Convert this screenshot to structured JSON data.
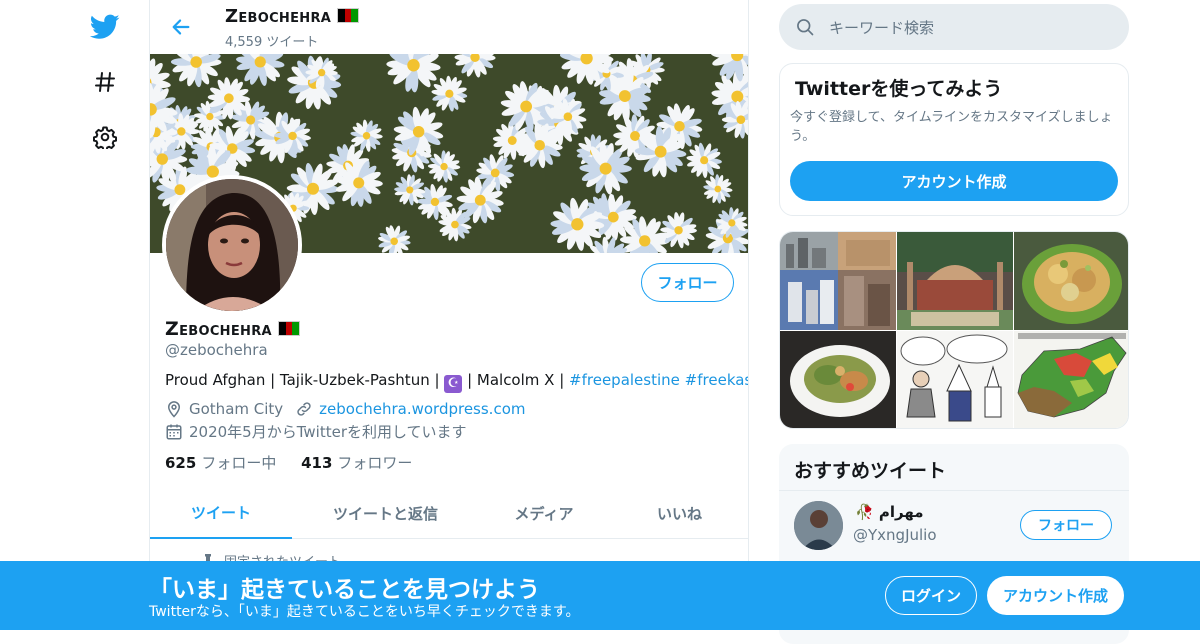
{
  "header": {
    "name": "Zebochehra",
    "tweet_count": "4,559 ツイート"
  },
  "profile": {
    "name": "Zebochehra",
    "handle": "@zebochehra",
    "bio_text": "Proud Afghan | Tajik-Uzbek-Pashtun | ",
    "bio_mid": " | Malcolm X | ",
    "bio_tags": [
      "#freepalestine",
      "#freekashmir"
    ],
    "bio_end": " |",
    "location": "Gotham City",
    "website": "zebochehra.wordpress.com",
    "joined": "2020年5月からTwitterを利用しています",
    "following_count": "625",
    "following_label": "フォロー中",
    "followers_count": "413",
    "followers_label": "フォロワー",
    "follow_button": "フォロー",
    "flag_colors": [
      "#000000",
      "#be0000",
      "#009900"
    ]
  },
  "tabs": [
    {
      "label": "ツイート",
      "active": true
    },
    {
      "label": "ツイートと返信",
      "active": false
    },
    {
      "label": "メディア",
      "active": false
    },
    {
      "label": "いいね",
      "active": false
    }
  ],
  "pinned_label": "固定されたツイート",
  "search": {
    "placeholder": "キーワード検索"
  },
  "signup_card": {
    "title": "Twitterを使ってみよう",
    "description": "今すぐ登録して、タイムラインをカスタマイズしましょう。",
    "button": "アカウント作成"
  },
  "recommended": {
    "title": "おすすめツイート",
    "user_name": "ﻣﻬﺮﺍﻡ",
    "user_handle": "@YxngJulio",
    "follow_button": "フォロー"
  },
  "bottom_bar": {
    "title": "「いま」起きていることを見つけよう",
    "subtitle": "Twitterなら、「いま」起きていることをいち早くチェックできます。",
    "login": "ログイン",
    "signup": "アカウント作成"
  },
  "colors": {
    "accent": "#1da1f2",
    "link": "#1b95e0",
    "muted": "#657786"
  },
  "icons": {
    "logo": "twitter-bird-icon",
    "explore": "hashtag-icon",
    "settings": "gear-icon",
    "back": "arrow-left-icon",
    "search": "search-icon",
    "location": "location-pin-icon",
    "link": "link-icon",
    "calendar": "calendar-icon",
    "pin": "pin-icon"
  }
}
